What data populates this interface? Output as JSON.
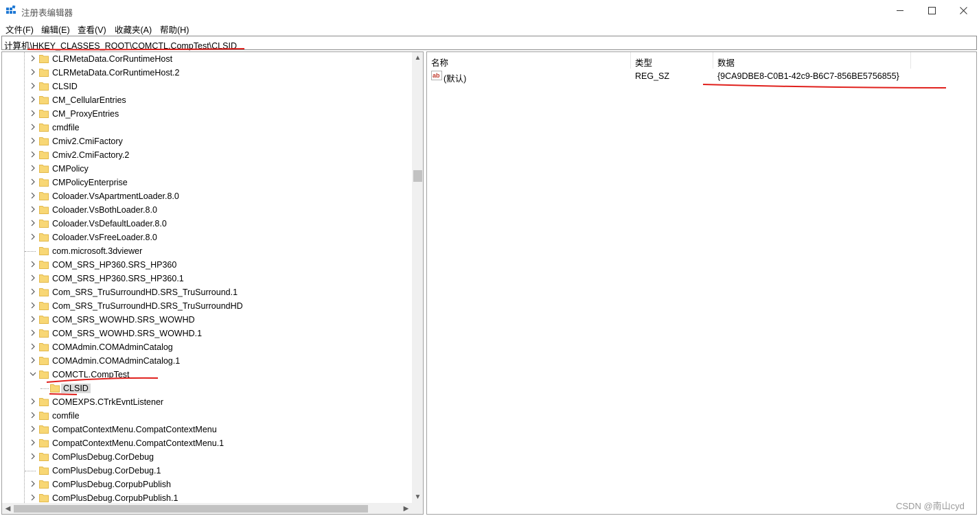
{
  "window": {
    "title": "注册表编辑器",
    "minimize_icon": "minimize-icon",
    "maximize_icon": "maximize-icon",
    "close_icon": "close-icon"
  },
  "menu": [
    "文件(F)",
    "编辑(E)",
    "查看(V)",
    "收藏夹(A)",
    "帮助(H)"
  ],
  "address": "计算机\\HKEY_CLASSES_ROOT\\COMCTL.CompTest\\CLSID",
  "tree": {
    "items": [
      {
        "label": "CLRMetaData.CorRuntimeHost",
        "arrow": "right",
        "indent": 0
      },
      {
        "label": "CLRMetaData.CorRuntimeHost.2",
        "arrow": "right",
        "indent": 0
      },
      {
        "label": "CLSID",
        "arrow": "right",
        "indent": 0
      },
      {
        "label": "CM_CellularEntries",
        "arrow": "right",
        "indent": 0
      },
      {
        "label": "CM_ProxyEntries",
        "arrow": "right",
        "indent": 0
      },
      {
        "label": "cmdfile",
        "arrow": "right",
        "indent": 0
      },
      {
        "label": "Cmiv2.CmiFactory",
        "arrow": "right",
        "indent": 0
      },
      {
        "label": "Cmiv2.CmiFactory.2",
        "arrow": "right",
        "indent": 0
      },
      {
        "label": "CMPolicy",
        "arrow": "right",
        "indent": 0
      },
      {
        "label": "CMPolicyEnterprise",
        "arrow": "right",
        "indent": 0
      },
      {
        "label": "Coloader.VsApartmentLoader.8.0",
        "arrow": "right",
        "indent": 0
      },
      {
        "label": "Coloader.VsBothLoader.8.0",
        "arrow": "right",
        "indent": 0
      },
      {
        "label": "Coloader.VsDefaultLoader.8.0",
        "arrow": "right",
        "indent": 0
      },
      {
        "label": "Coloader.VsFreeLoader.8.0",
        "arrow": "right",
        "indent": 0
      },
      {
        "label": "com.microsoft.3dviewer",
        "arrow": "none",
        "indent": 0
      },
      {
        "label": "COM_SRS_HP360.SRS_HP360",
        "arrow": "right",
        "indent": 0
      },
      {
        "label": "COM_SRS_HP360.SRS_HP360.1",
        "arrow": "right",
        "indent": 0
      },
      {
        "label": "Com_SRS_TruSurroundHD.SRS_TruSurround.1",
        "arrow": "right",
        "indent": 0
      },
      {
        "label": "Com_SRS_TruSurroundHD.SRS_TruSurroundHD",
        "arrow": "right",
        "indent": 0
      },
      {
        "label": "COM_SRS_WOWHD.SRS_WOWHD",
        "arrow": "right",
        "indent": 0
      },
      {
        "label": "COM_SRS_WOWHD.SRS_WOWHD.1",
        "arrow": "right",
        "indent": 0
      },
      {
        "label": "COMAdmin.COMAdminCatalog",
        "arrow": "right",
        "indent": 0
      },
      {
        "label": "COMAdmin.COMAdminCatalog.1",
        "arrow": "right",
        "indent": 0
      },
      {
        "label": "COMCTL.CompTest",
        "arrow": "down",
        "indent": 0
      },
      {
        "label": "CLSID",
        "arrow": "none",
        "indent": 1,
        "selected": true
      },
      {
        "label": "COMEXPS.CTrkEvntListener",
        "arrow": "right",
        "indent": 0
      },
      {
        "label": "comfile",
        "arrow": "right",
        "indent": 0
      },
      {
        "label": "CompatContextMenu.CompatContextMenu",
        "arrow": "right",
        "indent": 0
      },
      {
        "label": "CompatContextMenu.CompatContextMenu.1",
        "arrow": "right",
        "indent": 0
      },
      {
        "label": "ComPlusDebug.CorDebug",
        "arrow": "right",
        "indent": 0
      },
      {
        "label": "ComPlusDebug.CorDebug.1",
        "arrow": "none",
        "indent": 0
      },
      {
        "label": "ComPlusDebug.CorpubPublish",
        "arrow": "right",
        "indent": 0
      },
      {
        "label": "ComPlusDebug.CorpubPublish.1",
        "arrow": "right",
        "indent": 0
      }
    ],
    "folder_icon": "folder-icon",
    "folder_color": "#f8d775"
  },
  "values": {
    "columns": [
      "名称",
      "类型",
      "数据"
    ],
    "rows": [
      {
        "name": "(默认)",
        "type": "REG_SZ",
        "data": "{9CA9DBE8-C0B1-42c9-B6C7-856BE5756855}",
        "icon": "string-value-icon"
      }
    ]
  },
  "annotation_color": "#e0201c",
  "watermark": "CSDN @南山cyd"
}
